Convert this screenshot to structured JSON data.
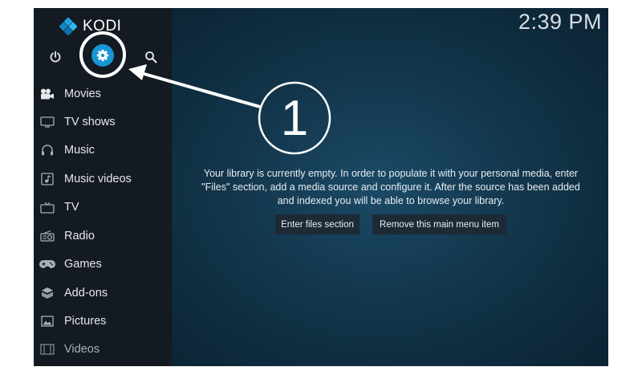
{
  "app": {
    "name": "KODI"
  },
  "header": {
    "clock": "2:39 PM"
  },
  "sidebar": {
    "top_icons": [
      "power-icon",
      "settings-icon",
      "search-icon"
    ],
    "items": [
      {
        "label": "Movies",
        "icon": "movies-icon"
      },
      {
        "label": "TV shows",
        "icon": "tv-shows-icon"
      },
      {
        "label": "Music",
        "icon": "music-icon"
      },
      {
        "label": "Music videos",
        "icon": "music-videos-icon"
      },
      {
        "label": "TV",
        "icon": "tv-icon"
      },
      {
        "label": "Radio",
        "icon": "radio-icon"
      },
      {
        "label": "Games",
        "icon": "games-icon"
      },
      {
        "label": "Add-ons",
        "icon": "addons-icon"
      },
      {
        "label": "Pictures",
        "icon": "pictures-icon"
      },
      {
        "label": "Videos",
        "icon": "videos-icon"
      }
    ]
  },
  "main": {
    "message_lines": [
      "Your library is currently empty. In order to populate it with your personal media, enter",
      "\"Files\" section, add a media source and configure it. After the source has been added",
      "and indexed you will be able to browse your library."
    ],
    "buttons": {
      "enter_files": "Enter files section",
      "remove_item": "Remove this main menu item"
    }
  },
  "annotation": {
    "step_number": "1"
  },
  "colors": {
    "accent": "#1896d4",
    "sidebar_bg": "#131a21",
    "button_bg": "#1c2a36",
    "annotation": "#ffffff"
  }
}
